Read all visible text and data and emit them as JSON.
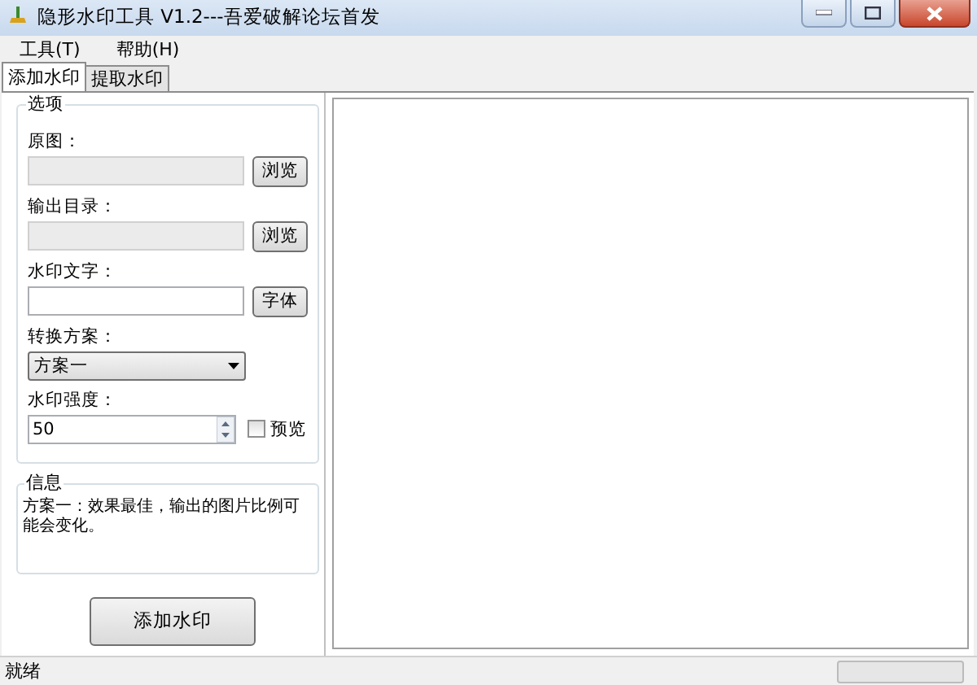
{
  "window": {
    "title": "隐形水印工具 V1.2---吾爱破解论坛首发"
  },
  "menu": [
    {
      "label": "工具(T)"
    },
    {
      "label": "帮助(H)"
    }
  ],
  "tabs": [
    {
      "label": "添加水印",
      "selected": true
    },
    {
      "label": "提取水印",
      "selected": false
    }
  ],
  "options": {
    "title": "选项",
    "fields": [
      {
        "kind": "path",
        "label": "原图：",
        "button": "浏览",
        "disabled": true
      },
      {
        "kind": "path",
        "label": "输出目录：",
        "button": "浏览",
        "disabled": true
      },
      {
        "kind": "text",
        "label": "水印文字：",
        "button": "字体",
        "disabled": false
      },
      {
        "kind": "select",
        "label": "转换方案：",
        "value": "方案一"
      },
      {
        "kind": "spin",
        "label": "水印强度：",
        "value": "50",
        "checkbox": {
          "label": "预览",
          "checked": false
        }
      }
    ]
  },
  "info": {
    "title": "信息",
    "text": "方案一：效果最佳，输出的图片比例可能会变化。"
  },
  "action_button": "添加水印",
  "status_bar": {
    "text": "就绪",
    "progress": {
      "level": 0
    }
  }
}
